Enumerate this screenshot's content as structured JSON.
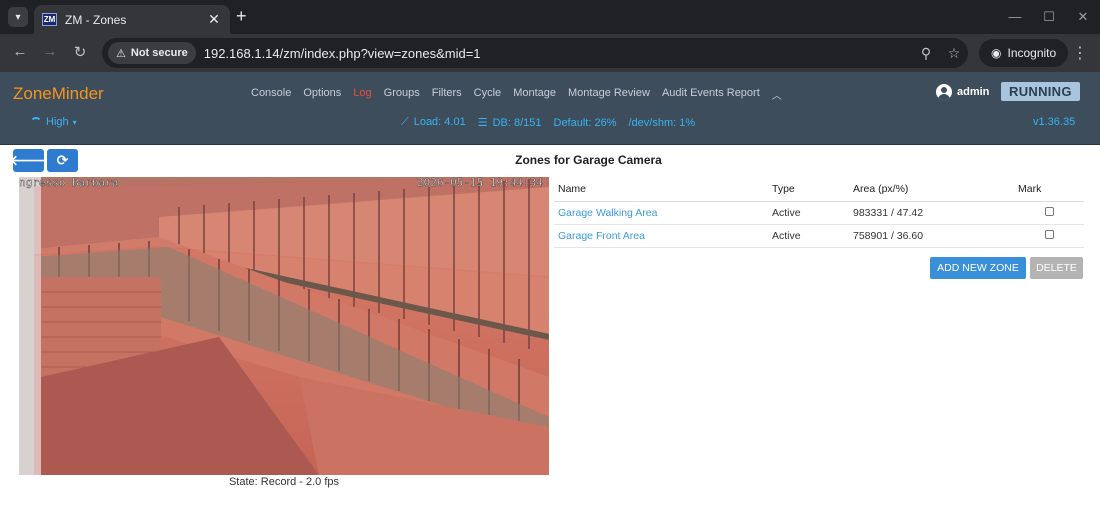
{
  "browser": {
    "tab_title": "ZM - Zones",
    "favicon_text": "ZM",
    "not_secure": "Not secure",
    "url": "192.168.1.14/zm/index.php?view=zones&mid=1",
    "incognito": "Incognito"
  },
  "header": {
    "brand": "ZoneMinder",
    "nav": [
      "Console",
      "Options",
      "Log",
      "Groups",
      "Filters",
      "Cycle",
      "Montage",
      "Montage Review",
      "Audit Events Report"
    ],
    "active_nav": "Log",
    "user": "admin",
    "status": "RUNNING",
    "bandwidth": "High",
    "load": "Load: 4.01",
    "db": "DB: 8/151",
    "default": "Default: 26%",
    "shm": "/dev/shm: 1%",
    "version": "v1.36.35"
  },
  "page": {
    "title": "Zones for Garage Camera",
    "camera_osd_left": "ngresso Barbara",
    "camera_osd_time": "2026-05-15 19:44:34",
    "state": "State: Record - 2.0 fps"
  },
  "zones_table": {
    "headers": [
      "Name",
      "Type",
      "Area (px/%)",
      "Mark"
    ],
    "rows": [
      {
        "name": "Garage Walking Area",
        "type": "Active",
        "area": "983331 / 47.42"
      },
      {
        "name": "Garage Front Area",
        "type": "Active",
        "area": "758901 / 36.60"
      }
    ]
  },
  "buttons": {
    "add_zone": "ADD NEW ZONE",
    "delete": "DELETE"
  },
  "colors": {
    "brand": "#f7941d",
    "header_bg": "#3e4d5c",
    "link": "#36b3f0",
    "primary_button": "#3a8fd9"
  }
}
